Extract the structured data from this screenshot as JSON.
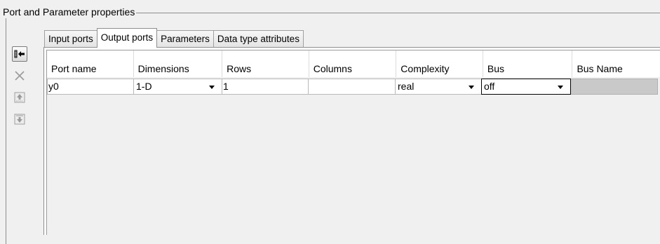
{
  "groupbox": {
    "title": "Port and Parameter properties"
  },
  "tabs": [
    {
      "label": "Input ports"
    },
    {
      "label": "Output ports"
    },
    {
      "label": "Parameters"
    },
    {
      "label": "Data type attributes"
    }
  ],
  "active_tab": "Output ports",
  "toolbar": {
    "buttons": [
      {
        "icon": "add-port-icon",
        "enabled": true
      },
      {
        "icon": "delete-icon",
        "enabled": false
      },
      {
        "icon": "move-up-icon",
        "enabled": false
      },
      {
        "icon": "move-down-icon",
        "enabled": false
      }
    ]
  },
  "table": {
    "columns": [
      "Port name",
      "Dimensions",
      "Rows",
      "Columns",
      "Complexity",
      "Bus",
      "Bus Name"
    ],
    "rows": [
      {
        "port_name": "y0",
        "dimensions": "1-D",
        "rows": "1",
        "columns": "",
        "complexity": "real",
        "bus": "off",
        "bus_name": ""
      }
    ]
  },
  "colors": {
    "background": "#f0f0f0",
    "disabled_cell": "#c9c9c9"
  }
}
